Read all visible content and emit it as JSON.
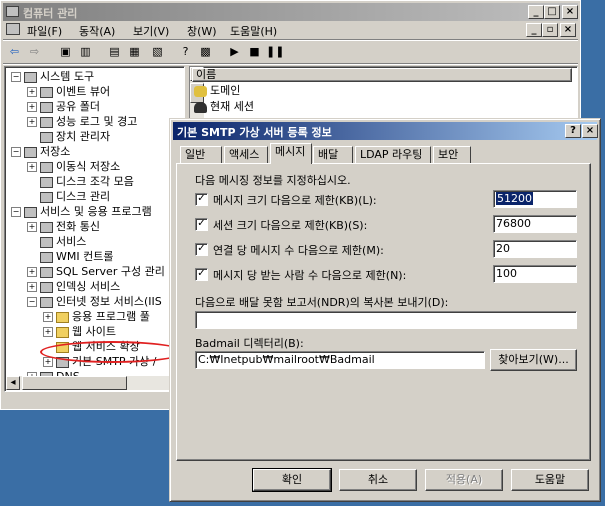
{
  "main_window": {
    "title": "컴퓨터 관리",
    "menu": [
      "파일(F)",
      "동작(A)",
      "보기(V)",
      "창(W)",
      "도움말(H)"
    ],
    "tree": [
      {
        "label": "시스템 도구",
        "level": 0,
        "exp": "−"
      },
      {
        "label": "이벤트 뷰어",
        "level": 1,
        "exp": "+"
      },
      {
        "label": "공유 폴더",
        "level": 1,
        "exp": "+"
      },
      {
        "label": "성능 로그 및 경고",
        "level": 1,
        "exp": "+"
      },
      {
        "label": "장치 관리자",
        "level": 1,
        "exp": ""
      },
      {
        "label": "저장소",
        "level": 0,
        "exp": "−"
      },
      {
        "label": "이동식 저장소",
        "level": 1,
        "exp": "+"
      },
      {
        "label": "디스크 조각 모음",
        "level": 1,
        "exp": ""
      },
      {
        "label": "디스크 관리",
        "level": 1,
        "exp": ""
      },
      {
        "label": "서비스 및 응용 프로그램",
        "level": 0,
        "exp": "−"
      },
      {
        "label": "전화 통신",
        "level": 1,
        "exp": "+"
      },
      {
        "label": "서비스",
        "level": 1,
        "exp": ""
      },
      {
        "label": "WMI 컨트롤",
        "level": 1,
        "exp": ""
      },
      {
        "label": "SQL Server 구성 관리",
        "level": 1,
        "exp": "+"
      },
      {
        "label": "인덱싱 서비스",
        "level": 1,
        "exp": "+"
      },
      {
        "label": "인터넷 정보 서비스(IIS",
        "level": 1,
        "exp": "−"
      },
      {
        "label": "응용 프로그램 풀",
        "level": 2,
        "exp": "+"
      },
      {
        "label": "웹 사이트",
        "level": 2,
        "exp": "+"
      },
      {
        "label": "웹 서비스 확장",
        "level": 2,
        "exp": ""
      },
      {
        "label": "기본 SMTP 가상 /",
        "level": 2,
        "exp": "+"
      },
      {
        "label": "DNS",
        "level": 1,
        "exp": "+"
      }
    ],
    "list_header": "이름",
    "list_items": [
      "도메인",
      "현재 세션"
    ]
  },
  "dialog": {
    "title": "기본 SMTP 가상 서버 등록 정보",
    "tabs": [
      "일반",
      "액세스",
      "메시지",
      "배달",
      "LDAP 라우팅",
      "보안"
    ],
    "active_tab": "메시지",
    "instruction": "다음 메시징 정보를 지정하십시오.",
    "limits": [
      {
        "label": "메시지 크기 다음으로 제한(KB)(L):",
        "value": "51200",
        "checked": true
      },
      {
        "label": "세션 크기 다음으로 제한(KB)(S):",
        "value": "76800",
        "checked": true
      },
      {
        "label": "연결 당 메시지 수 다음으로 제한(M):",
        "value": "20",
        "checked": true
      },
      {
        "label": "메시지 당 받는 사람 수 다음으로 제한(N):",
        "value": "100",
        "checked": true
      }
    ],
    "ndr_label": "다음으로 배달 못함 보고서(NDR)의 복사본 보내기(D):",
    "ndr_value": "",
    "badmail_label": "Badmail 디렉터리(B):",
    "badmail_value": "C:₩Inetpub₩mailroot₩Badmail",
    "browse_button": "찾아보기(W)...",
    "ok_button": "확인",
    "cancel_button": "취소",
    "apply_button": "적용(A)",
    "help_button": "도움말"
  }
}
